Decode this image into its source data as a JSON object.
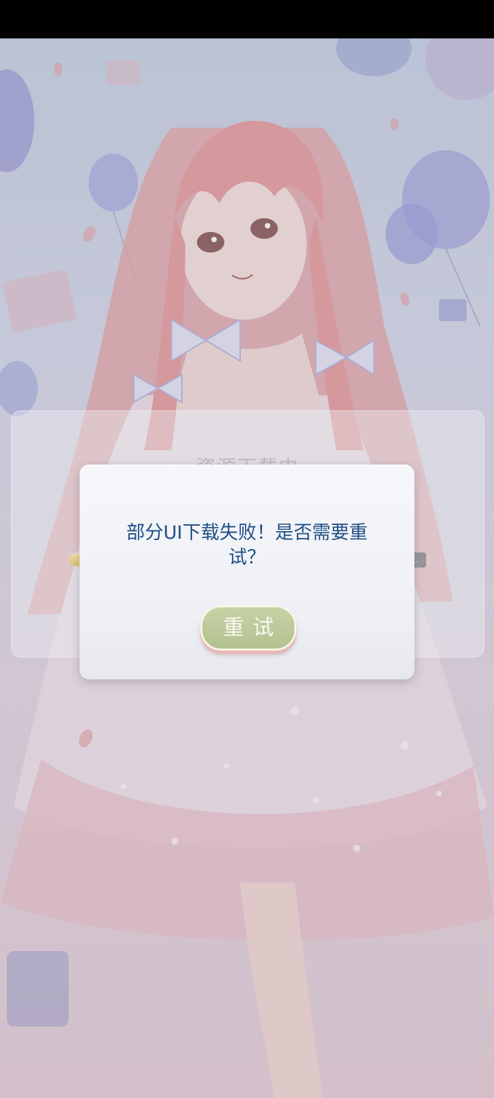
{
  "background": {
    "loading_title": "资源下载中",
    "progress_label": "下载中...",
    "progress_fraction": 0.8
  },
  "dialog": {
    "message": "部分UI下载失败！是否需要重试？",
    "retry_label": "重试"
  },
  "colors": {
    "message_text": "#1f4f86",
    "retry_button": "#b3c08f",
    "dialog_bg": "#f2f3f7"
  }
}
